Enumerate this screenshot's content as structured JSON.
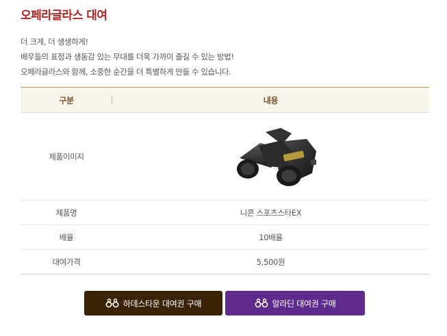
{
  "page": {
    "title": "오페라글라스 대여",
    "intro": [
      "더 크게, 더 생생하게!",
      "배우들의 표정과 생동감 있는 무대를 더욱 가까이 즐길 수 있는 방법!",
      "오페라글라스와 함께, 소중한 순간을 더 특별하게 만들 수 있습니다."
    ]
  },
  "table": {
    "headers": {
      "key": "구분",
      "value": "내용"
    },
    "rows": {
      "image_label": "제품이미지",
      "name": {
        "label": "제품명",
        "value": "니콘 스포츠스타EX"
      },
      "magnification": {
        "label": "배율",
        "value": "10배율"
      },
      "price": {
        "label": "대여가격",
        "value": "5,500원"
      }
    }
  },
  "buttons": {
    "hadesta": "하데스타운 대여권 구매",
    "aladdin": "알라딘 대여권 구매"
  },
  "colors": {
    "title": "#b32323",
    "hadesta_button": "#3a2307",
    "aladdin_button": "#5e2a8e",
    "table_header_bg": "#f8f4ec"
  },
  "icons": [
    "binoculars-icon",
    "opera-glass-icon"
  ]
}
